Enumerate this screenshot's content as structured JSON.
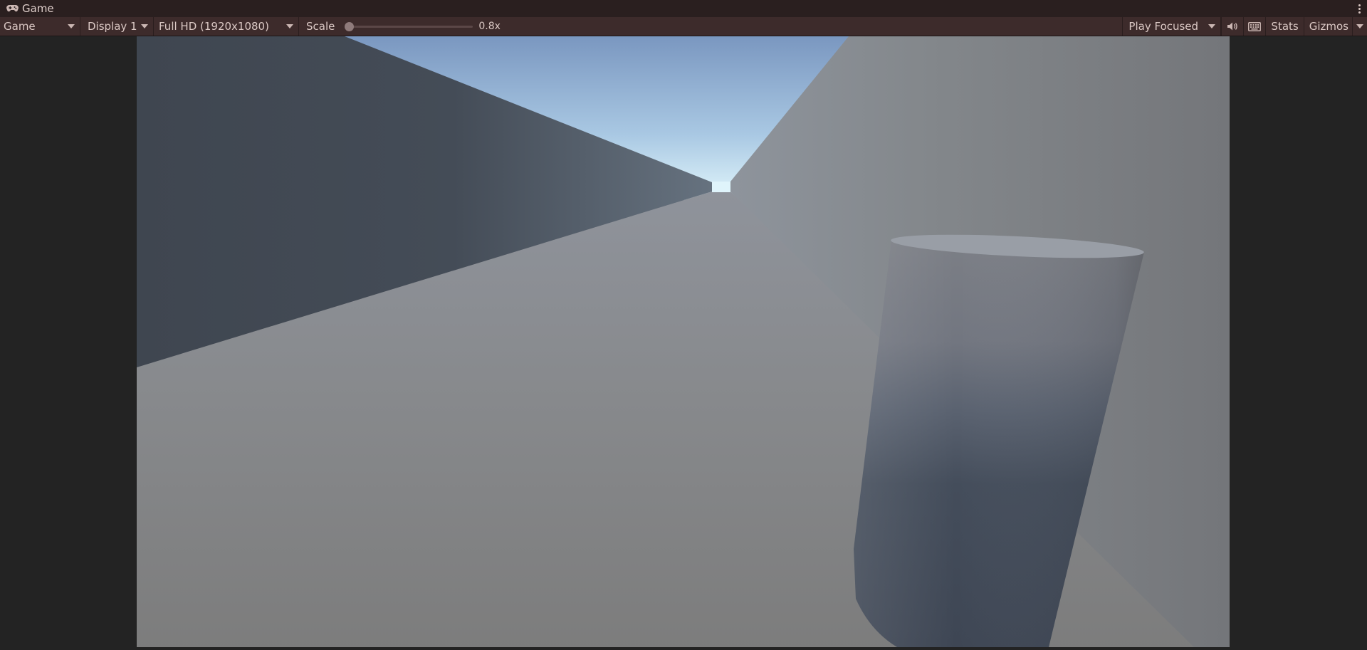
{
  "window": {
    "tab_title": "Game",
    "tab_icon": "gamepad-icon"
  },
  "toolbar": {
    "view_mode": "Game",
    "display": "Display 1",
    "resolution": "Full HD (1920x1080)",
    "scale_label": "Scale",
    "scale_value": "0.8x",
    "play_mode": "Play Focused",
    "stats_label": "Stats",
    "gizmos_label": "Gizmos",
    "icons": [
      "audio-mute-icon",
      "keyboard-icon",
      "more-options-icon"
    ]
  },
  "colors": {
    "titlebar": "#2a1f1f",
    "toolbar": "#3d2b2b",
    "side_panels": "#232323",
    "sky_top": "#7f9cc4",
    "sky_horizon": "#d9f2fb",
    "floor": "#8a8c90",
    "left_wall": "#3f4752",
    "right_wall": "#8a8c8e",
    "cylinder": "#4a5564"
  }
}
